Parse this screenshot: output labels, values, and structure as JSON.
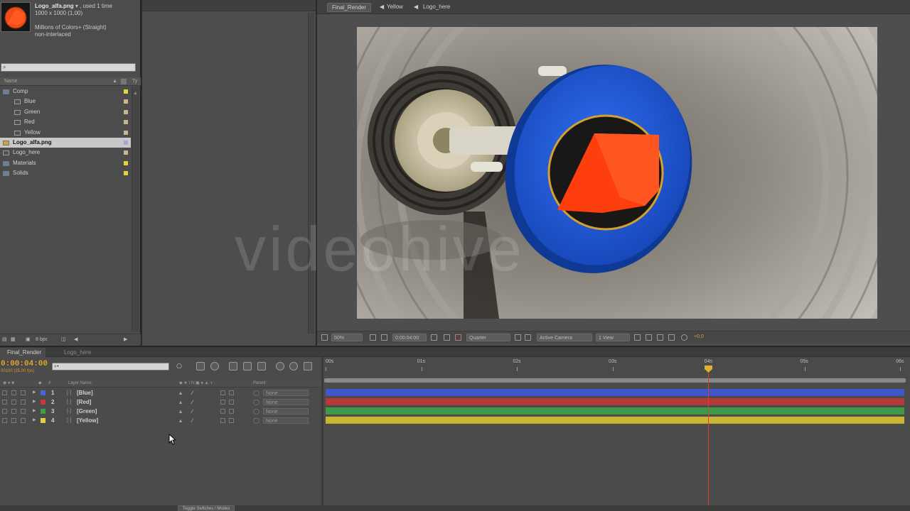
{
  "project": {
    "file_name": "Logo_alfa.png",
    "used": "▾ , used 1 time",
    "dimensions": "1000 x 1000 (1,00)",
    "colors": "Millions of Colors+ (Straight)",
    "interlace": "non-interlaced",
    "search_placeholder": "⌕",
    "header_name": "Name",
    "header_type": "Ty",
    "items": [
      {
        "label": "Comp",
        "kind": "folder",
        "indent": 0,
        "color": "#e8d23a"
      },
      {
        "label": "Blue",
        "kind": "comp",
        "indent": 1,
        "color": "#c9b590"
      },
      {
        "label": "Green",
        "kind": "comp",
        "indent": 1,
        "color": "#c9b590"
      },
      {
        "label": "Red",
        "kind": "comp",
        "indent": 1,
        "color": "#c9b590"
      },
      {
        "label": "Yellow",
        "kind": "comp",
        "indent": 1,
        "color": "#c9b590"
      },
      {
        "label": "Logo_alfa.png",
        "kind": "image",
        "indent": 0,
        "color": "#a6a6d8",
        "selected": true
      },
      {
        "label": "Logo_here",
        "kind": "comp",
        "indent": 0,
        "color": "#c9b590"
      },
      {
        "label": "Materials",
        "kind": "folder",
        "indent": 0,
        "color": "#e8d23a"
      },
      {
        "label": "Solids",
        "kind": "folder",
        "indent": 0,
        "color": "#e8d23a"
      }
    ],
    "footer_bpc": "8 bpc"
  },
  "viewer": {
    "breadcrumbs": [
      "Final_Render",
      "Yellow",
      "Logo_here"
    ],
    "zoom": "50%",
    "timecode": "0:00:04:00",
    "resolution": "Quarter",
    "camera": "Active Camera",
    "views": "1 View",
    "exposure": "+0,0"
  },
  "watermark": "videohive",
  "timeline": {
    "tabs": [
      "Final_Render",
      "Logo_here"
    ],
    "timecode": "0:00:04:00",
    "timecode_sub": "00100 (25.00 fps)",
    "search_placeholder": "⌕▾",
    "header": {
      "source": "Layer Name",
      "parent": "Parent",
      "num": "#"
    },
    "layers": [
      {
        "num": "1",
        "name": "[Blue]",
        "label_color": "#4a66d8",
        "bar_color": "#3f57c8",
        "parent": "None"
      },
      {
        "num": "2",
        "name": "[Red]",
        "label_color": "#c83a3a",
        "bar_color": "#b43a3a",
        "parent": "None"
      },
      {
        "num": "3",
        "name": "[Green]",
        "label_color": "#3aa04a",
        "bar_color": "#3f9a48",
        "parent": "None"
      },
      {
        "num": "4",
        "name": "[Yellow]",
        "label_color": "#e0d040",
        "bar_color": "#c9b531",
        "parent": "None"
      }
    ],
    "ruler": [
      "00s",
      "01s",
      "02s",
      "03s",
      "04s",
      "05s",
      "06s"
    ],
    "toggle_label": "Toggle Switches / Modes"
  },
  "colors": {
    "accent": "#e0a22a",
    "playhead": "#e23b2b",
    "selection": "#c8c8c8"
  }
}
